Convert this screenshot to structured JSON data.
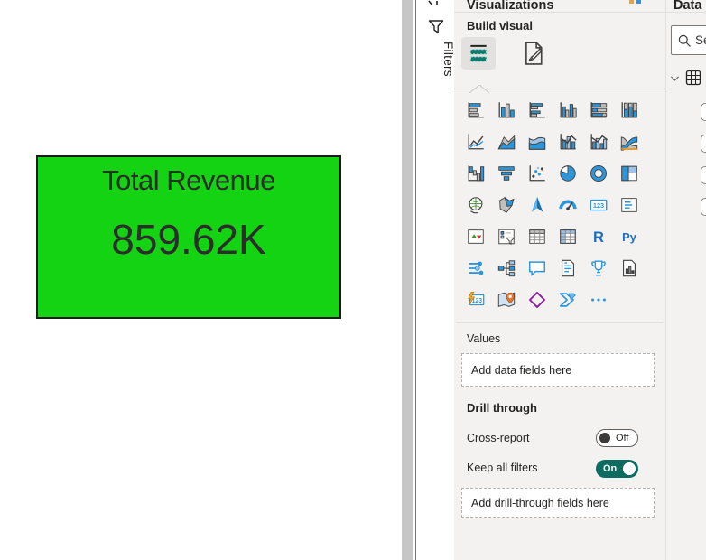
{
  "canvas": {
    "card": {
      "title": "Total Revenue",
      "value": "859.62K",
      "bg_color": "#13d313",
      "border_color": "#1c1c1c"
    }
  },
  "filters_pane": {
    "label": "Filters"
  },
  "viz": {
    "title": "Visualizations",
    "build_label": "Build visual",
    "tabs": [
      {
        "name": "build-visual",
        "selected": true
      },
      {
        "name": "format-visual",
        "selected": false
      }
    ],
    "gallery": [
      {
        "name": "stacked-bar-chart",
        "title": "Stacked bar chart"
      },
      {
        "name": "stacked-column-chart",
        "title": "Stacked column chart"
      },
      {
        "name": "clustered-bar-chart",
        "title": "Clustered bar chart"
      },
      {
        "name": "clustered-column-chart",
        "title": "Clustered column chart"
      },
      {
        "name": "hundred-stacked-bar-chart",
        "title": "100% Stacked bar chart"
      },
      {
        "name": "hundred-stacked-column-chart",
        "title": "100% Stacked column chart"
      },
      {
        "name": "line-chart",
        "title": "Line chart"
      },
      {
        "name": "area-chart",
        "title": "Area chart"
      },
      {
        "name": "stacked-area-chart",
        "title": "Stacked area chart"
      },
      {
        "name": "line-and-stacked-column-chart",
        "title": "Line and stacked column chart"
      },
      {
        "name": "line-and-clustered-column-chart",
        "title": "Line and clustered column chart"
      },
      {
        "name": "ribbon-chart",
        "title": "Ribbon chart"
      },
      {
        "name": "waterfall-chart",
        "title": "Waterfall chart"
      },
      {
        "name": "funnel-chart",
        "title": "Funnel"
      },
      {
        "name": "scatter-chart",
        "title": "Scatter chart"
      },
      {
        "name": "pie-chart",
        "title": "Pie chart"
      },
      {
        "name": "donut-chart",
        "title": "Donut chart"
      },
      {
        "name": "treemap",
        "title": "Treemap"
      },
      {
        "name": "map",
        "title": "Map"
      },
      {
        "name": "filled-map",
        "title": "Filled map"
      },
      {
        "name": "azure-map",
        "title": "Azure map"
      },
      {
        "name": "gauge",
        "title": "Gauge"
      },
      {
        "name": "card",
        "title": "Card"
      },
      {
        "name": "multi-row-card",
        "title": "Multi-row card"
      },
      {
        "name": "kpi",
        "title": "KPI"
      },
      {
        "name": "slicer",
        "title": "Slicer"
      },
      {
        "name": "table",
        "title": "Table"
      },
      {
        "name": "matrix",
        "title": "Matrix"
      },
      {
        "name": "r-script-visual",
        "title": "R script visual"
      },
      {
        "name": "python-visual",
        "title": "Python visual"
      },
      {
        "name": "key-influencers",
        "title": "Key influencers"
      },
      {
        "name": "decomposition-tree",
        "title": "Decomposition tree"
      },
      {
        "name": "qa-visual",
        "title": "Q&A"
      },
      {
        "name": "smart-narrative",
        "title": "Smart narrative"
      },
      {
        "name": "metrics",
        "title": "Metrics"
      },
      {
        "name": "paginated-report",
        "title": "Paginated report"
      },
      {
        "name": "card-new",
        "title": "Card (new)"
      },
      {
        "name": "arcgis-maps",
        "title": "ArcGIS Maps for Power BI"
      },
      {
        "name": "power-apps",
        "title": "Power Apps for Power BI"
      },
      {
        "name": "power-automate",
        "title": "Power Automate for Power BI"
      },
      {
        "name": "more-options",
        "title": "Get more visuals"
      }
    ],
    "values": {
      "label": "Values",
      "placeholder": "Add data fields here"
    },
    "drill": {
      "label": "Drill through",
      "cross_label": "Cross-report",
      "cross_state": "Off",
      "keep_label": "Keep all filters",
      "keep_state": "On",
      "placeholder": "Add drill-through fields here"
    }
  },
  "data_pane": {
    "title": "Data",
    "search_placeholder": "Search",
    "field_rows": 4
  },
  "colors": {
    "accent_blue": "#2E96D8",
    "toggle_on": "#0e6b60",
    "build_teal": "#0f7b6f",
    "pane_bg": "#f3f2f1",
    "card_green": "#13d313"
  }
}
